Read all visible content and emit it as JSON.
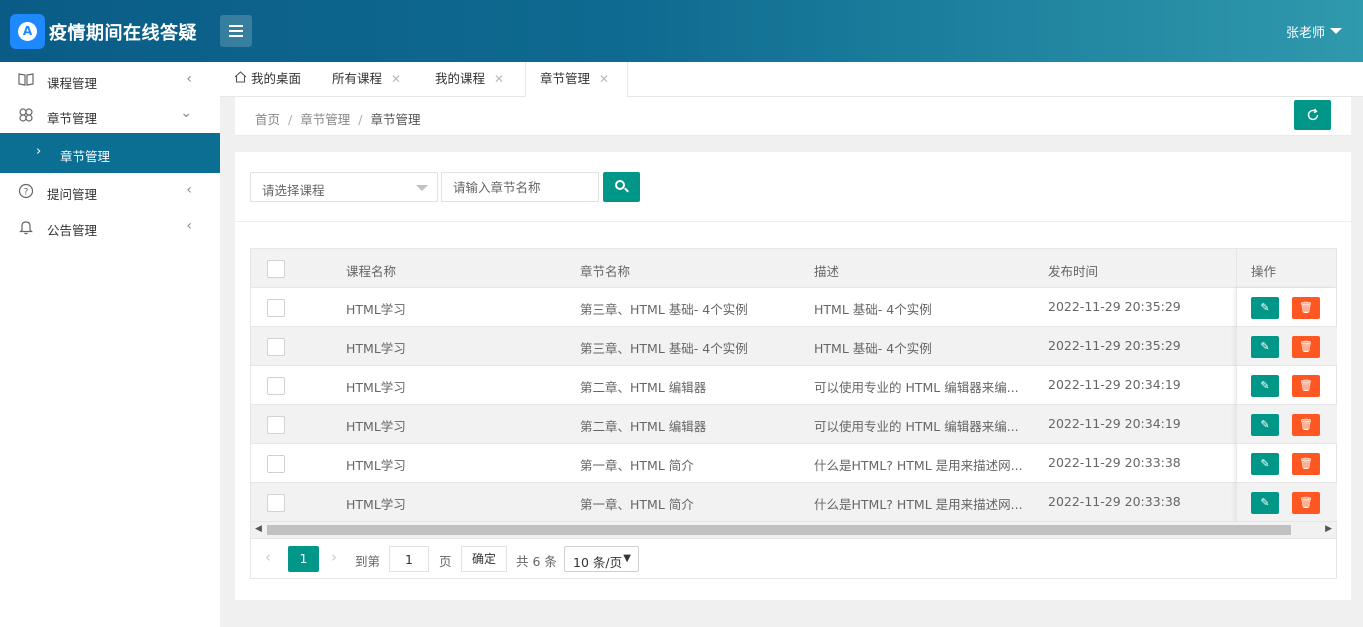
{
  "header": {
    "logo_letter": "A",
    "app_title": "疫情期间在线答疑",
    "user_name": "张老师"
  },
  "sidebar": {
    "items": [
      {
        "label": "课程管理",
        "icon": "book-icon"
      },
      {
        "label": "章节管理",
        "icon": "clover-icon"
      },
      {
        "label": "提问管理",
        "icon": "question-circle-icon"
      },
      {
        "label": "公告管理",
        "icon": "bell-icon"
      }
    ],
    "sub_item": {
      "label": "章节管理"
    }
  },
  "tabs": [
    {
      "label": "我的桌面",
      "closable": false
    },
    {
      "label": "所有课程",
      "closable": true
    },
    {
      "label": "我的课程",
      "closable": true
    },
    {
      "label": "章节管理",
      "closable": true,
      "active": true
    }
  ],
  "breadcrumb": {
    "items": [
      "首页",
      "章节管理",
      "章节管理"
    ]
  },
  "search": {
    "course_placeholder": "请选择课程",
    "chapter_placeholder": "请输入章节名称"
  },
  "table": {
    "headers": {
      "course": "课程名称",
      "chapter": "章节名称",
      "desc": "描述",
      "time": "发布时间",
      "ops": "操作"
    },
    "rows": [
      {
        "course": "HTML学习",
        "chapter": "第三章、HTML 基础- 4个实例",
        "desc": "HTML 基础- 4个实例",
        "time": "2022-11-29 20:35:29"
      },
      {
        "course": "HTML学习",
        "chapter": "第三章、HTML 基础- 4个实例",
        "desc": "HTML 基础- 4个实例",
        "time": "2022-11-29 20:35:29"
      },
      {
        "course": "HTML学习",
        "chapter": "第二章、HTML 编辑器",
        "desc": "可以使用专业的 HTML 编辑器来编...",
        "time": "2022-11-29 20:34:19"
      },
      {
        "course": "HTML学习",
        "chapter": "第二章、HTML 编辑器",
        "desc": "可以使用专业的 HTML 编辑器来编...",
        "time": "2022-11-29 20:34:19"
      },
      {
        "course": "HTML学习",
        "chapter": "第一章、HTML 简介",
        "desc": "什么是HTML? HTML 是用来描述网...",
        "time": "2022-11-29 20:33:38"
      },
      {
        "course": "HTML学习",
        "chapter": "第一章、HTML 简介",
        "desc": "什么是HTML? HTML 是用来描述网...",
        "time": "2022-11-29 20:33:38"
      }
    ]
  },
  "pager": {
    "current": "1",
    "goto_label": "到第",
    "goto_value": "1",
    "page_label": "页",
    "confirm_label": "确定",
    "total_label": "共 6 条",
    "page_size": "10 条/页"
  },
  "colors": {
    "primary": "#009688",
    "danger": "#ff5722",
    "sidebar_active": "#0a6f93",
    "header_start": "#0a5c86",
    "header_end": "#2f99ad"
  }
}
